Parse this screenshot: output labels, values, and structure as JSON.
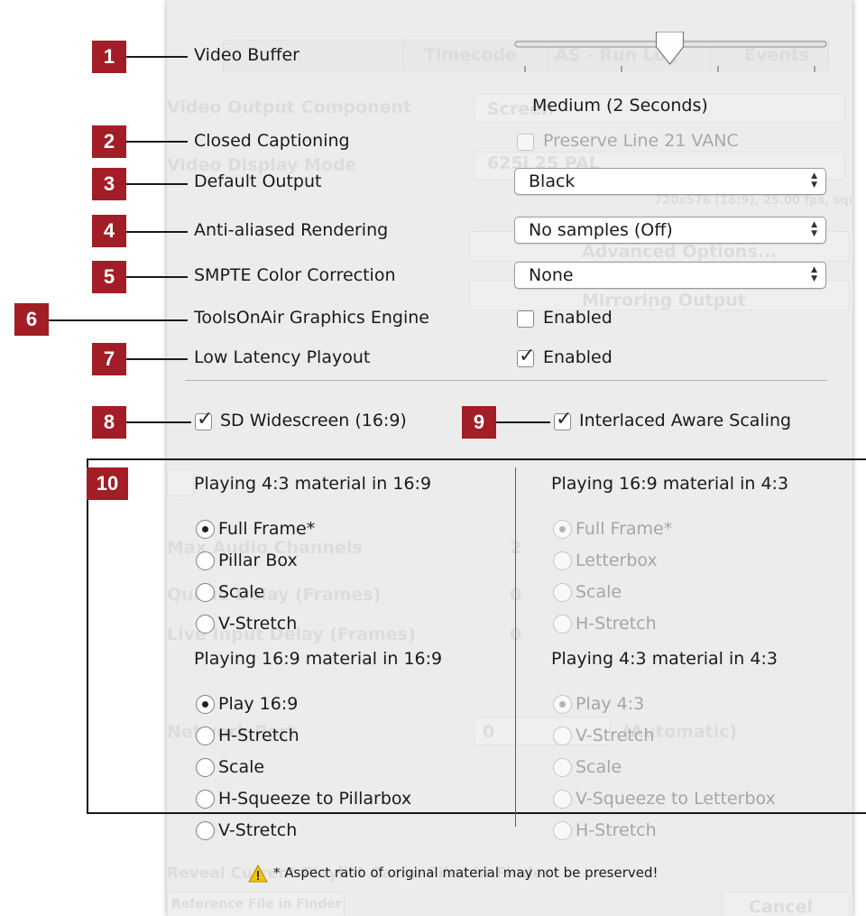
{
  "background_tabs": [
    "Timecode",
    "AS - Run Log",
    "Events"
  ],
  "background_labels": [
    "Video Output Component",
    "Screen",
    "Video Display Mode",
    "625i 25 PAL",
    "720x576 (16:9), 25.00 fps, square pixels",
    "Advanced Options...",
    "Mirroring Output",
    "Max Audio Channels",
    "2",
    "Queue Delay (Frames)",
    "0",
    "Live Input Delay (Frames)",
    "0",
    "Network Port",
    "0",
    "(Automatic)",
    "Reveal Current Playlist Cache Files in Finder",
    "Reference File in Finder",
    "Cancel"
  ],
  "badges": [
    "1",
    "2",
    "3",
    "4",
    "5",
    "6",
    "7",
    "8",
    "9",
    "10"
  ],
  "settings": {
    "video_buffer": {
      "label": "Video Buffer",
      "value_text": "Medium (2 Seconds)",
      "level": 0.5
    },
    "closed_captioning": {
      "label": "Closed Captioning",
      "option": "Preserve Line 21 VANC",
      "checked": false,
      "enabled": false
    },
    "default_output": {
      "label": "Default Output",
      "value": "Black"
    },
    "anti_aliased": {
      "label": "Anti-aliased Rendering",
      "value": "No samples (Off)"
    },
    "smpte": {
      "label": "SMPTE Color Correction",
      "value": "None"
    },
    "toolsonair": {
      "label": "ToolsOnAir Graphics Engine",
      "option": "Enabled",
      "checked": false
    },
    "low_latency": {
      "label": "Low Latency Playout",
      "option": "Enabled",
      "checked": true
    },
    "sd_widescreen": {
      "label": "SD Widescreen (16:9)",
      "checked": true
    },
    "interlaced": {
      "label": "Interlaced Aware Scaling",
      "checked": true
    }
  },
  "groups": {
    "g1": {
      "title": "Playing 4:3 material in 16:9",
      "options": [
        "Full Frame*",
        "Pillar Box",
        "Scale",
        "V-Stretch"
      ],
      "selected": 0,
      "enabled": true
    },
    "g2": {
      "title": "Playing 16:9 material in 4:3",
      "options": [
        "Full Frame*",
        "Letterbox",
        "Scale",
        "H-Stretch"
      ],
      "selected": 0,
      "enabled": false
    },
    "g3": {
      "title": "Playing 16:9 material in 16:9",
      "options": [
        "Play 16:9",
        "H-Stretch",
        "Scale",
        "H-Squeeze to Pillarbox",
        "V-Stretch"
      ],
      "selected": 0,
      "enabled": true
    },
    "g4": {
      "title": "Playing 4:3 material in 4:3",
      "options": [
        "Play 4:3",
        "V-Stretch",
        "Scale",
        "V-Squeeze to Letterbox",
        "H-Stretch"
      ],
      "selected": 0,
      "enabled": false
    }
  },
  "warning": "* Aspect ratio of original material may not be preserved!",
  "colors": {
    "badge": "#a21d26",
    "panel": "#ececec",
    "warning_icon": "#f2c200"
  }
}
